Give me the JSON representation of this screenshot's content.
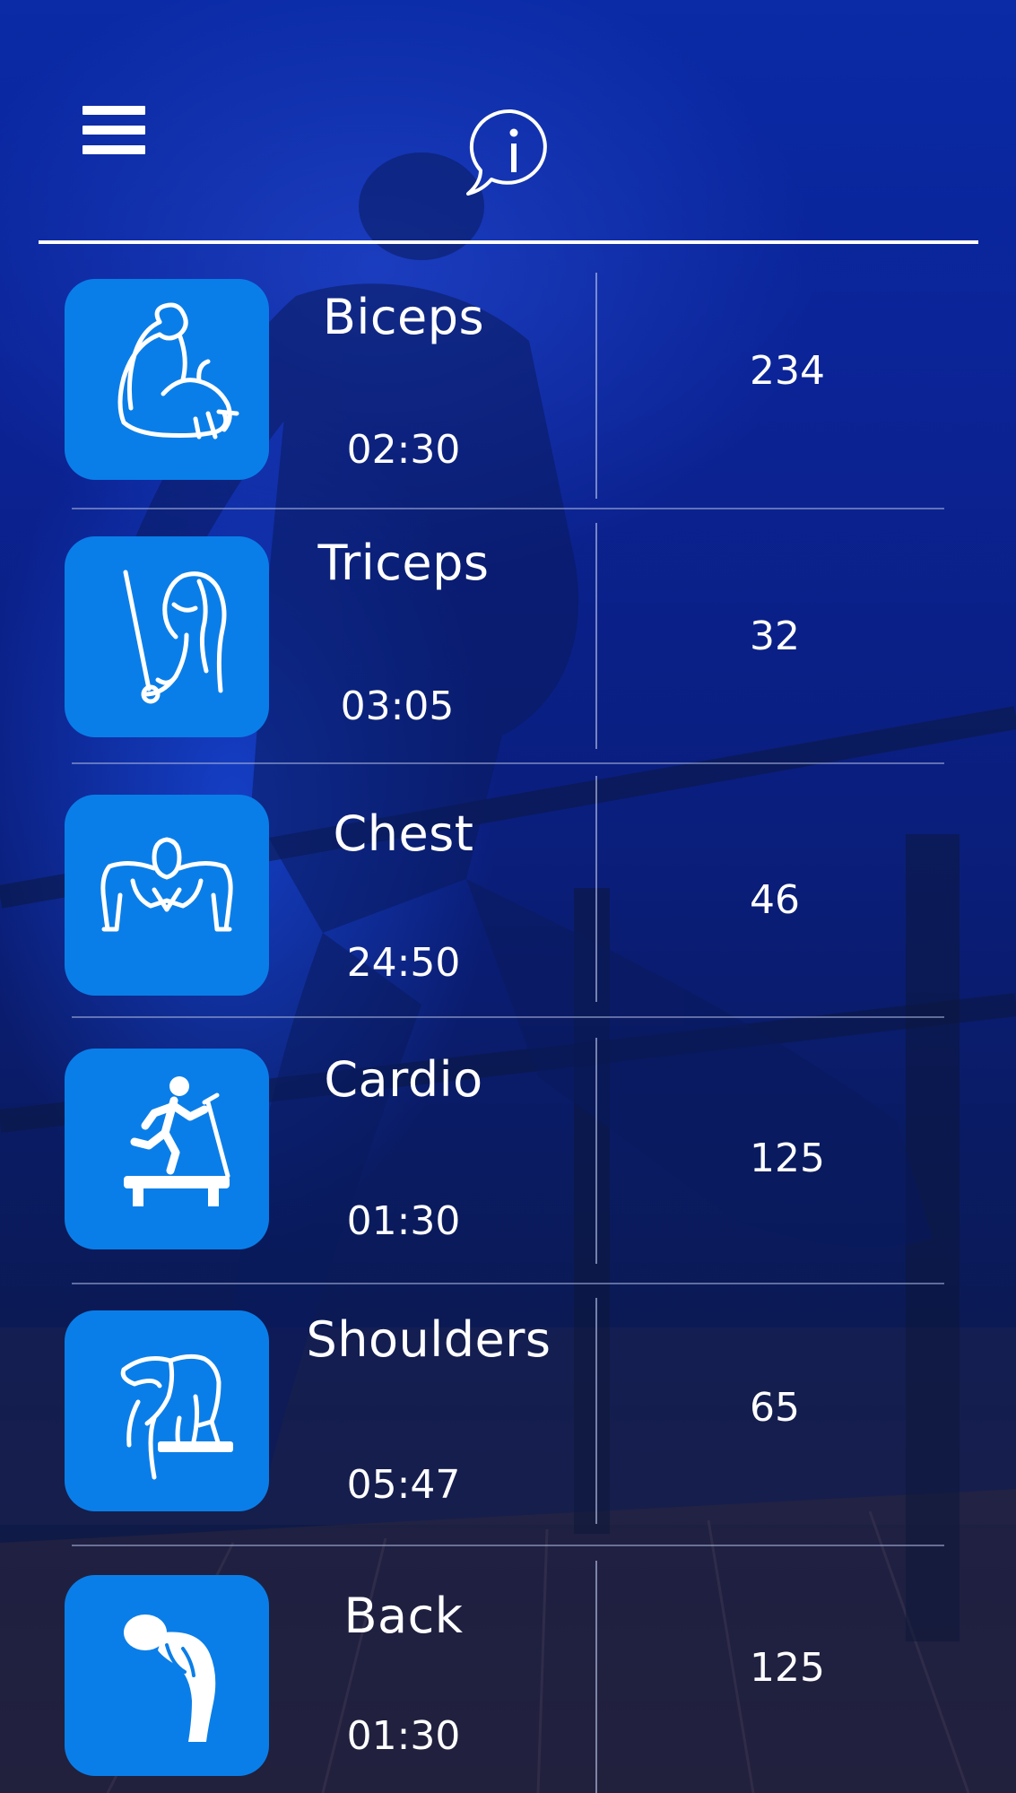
{
  "header": {
    "menu_icon": "hamburger-menu-icon",
    "info_icon": "info-speech-bubble-icon"
  },
  "colors": {
    "tile": "#0a7ee8",
    "text": "#ffffff",
    "divider": "#ffffff"
  },
  "exercises": [
    {
      "name": "Biceps",
      "time": "02:30",
      "count": "234",
      "icon": "biceps-icon"
    },
    {
      "name": "Triceps",
      "time": "03:05",
      "count": "32",
      "icon": "triceps-cable-icon"
    },
    {
      "name": "Chest",
      "time": "24:50",
      "count": "46",
      "icon": "chest-pushup-icon"
    },
    {
      "name": "Cardio",
      "time": "01:30",
      "count": "125",
      "icon": "treadmill-icon"
    },
    {
      "name": "Shoulders",
      "time": "05:47",
      "count": "65",
      "icon": "shoulders-icon"
    },
    {
      "name": "Back",
      "time": "01:30",
      "count": "125",
      "icon": "back-icon"
    }
  ]
}
